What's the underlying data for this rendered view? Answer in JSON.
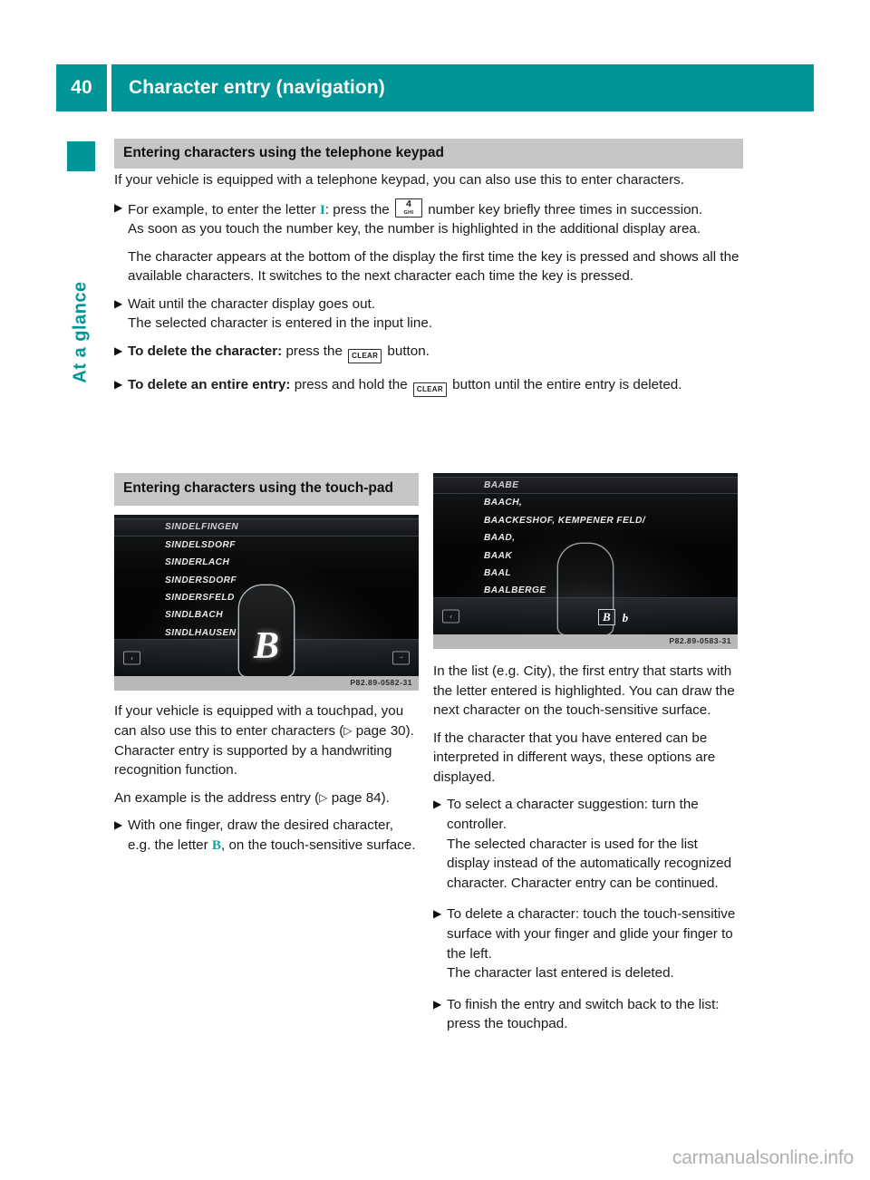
{
  "colors": {
    "accent_teal": "#009597",
    "heading_grey": "#c6c6c6",
    "figure_grey": "#b8b8b8",
    "watermark_grey": "#b0b0b0"
  },
  "header": {
    "page_number": "40",
    "title": "Character entry (navigation)"
  },
  "sidebar": {
    "chapter_label": "At a glance"
  },
  "section_keypad": {
    "heading": "Entering characters using the telephone keypad",
    "intro": "If your vehicle is equipped with a telephone keypad, you can also use this to enter characters.",
    "bullets": [
      {
        "id": "example-letter",
        "text_before": "For example, to enter the letter ",
        "inline_char": "I",
        "text_mid": ": press the ",
        "key": {
          "number": "4",
          "letters": "GHI"
        },
        "text_after": "number key briefly three times in succession.",
        "sub_lines": [
          "As soon as you touch the number key, the number is highlighted in the additional display area.",
          "The character appears at the bottom of the display the first time the key is pressed and shows all the available characters. It switches to the next character each time the key is pressed."
        ]
      },
      {
        "id": "wait-display",
        "text": "Wait until the character display goes out.",
        "sub_lines": [
          "The selected character is entered in the input line."
        ]
      },
      {
        "id": "delete-character",
        "lead": "To delete the character:",
        "text_before": " press the ",
        "key_label": "CLEAR",
        "text_after": " button."
      },
      {
        "id": "delete-entry",
        "lead": "To delete an entire entry:",
        "text_before": " press and hold the ",
        "key_label": "CLEAR",
        "text_after": " button until the entire entry is deleted."
      }
    ]
  },
  "section_touchpad": {
    "heading": "Entering characters using the touch-pad",
    "figure_left": {
      "caption": "P82.89-0582-31",
      "list_items": [
        "SINDELFINGEN",
        "SINDELSDORF",
        "SINDERLACH",
        "SINDERSDORF",
        "SINDERSFELD",
        "SINDLBACH",
        "SINDLHAUSEN"
      ],
      "selected_index": 0,
      "drawn_character": "B",
      "back_button": "‹",
      "forward_button": "→"
    },
    "figure_right": {
      "caption": "P82.89-0583-31",
      "list_items": [
        "BAABE",
        "BAACH,",
        "BAACKESHOF, KEMPENER FELD/",
        "BAAD,",
        "BAAK",
        "BAAL",
        "BAALBERGE"
      ],
      "selected_index": 0,
      "back_button": "‹",
      "suggestions": [
        {
          "label": "B",
          "active": true
        },
        {
          "label": "b",
          "active": false
        }
      ]
    },
    "left_column": {
      "paragraphs": [
        {
          "id": "touchpad-intro",
          "text_before": "If your vehicle is equipped with a touchpad, you can also use this to enter characters (",
          "ref_arrow": "▷",
          "ref_text": " page 30",
          "text_after": "). Character entry is supported by a handwriting recognition function."
        },
        {
          "id": "address-example",
          "text_before": "An example is the address entry (",
          "ref_arrow": "▷",
          "ref_text": " page 84",
          "text_after": ")."
        }
      ],
      "bullets": [
        {
          "id": "draw-character",
          "text_before": "With one finger, draw the desired character, e.g. the letter ",
          "inline_char": "B",
          "text_after": ", on the touch-sensitive surface."
        }
      ]
    },
    "right_column": {
      "paragraphs": [
        {
          "id": "list-highlight",
          "text": "In the list (e.g. City), the first entry that starts with the letter entered is highlighted. You can draw the next character on the touch-sensitive surface."
        },
        {
          "id": "interpretation-options",
          "text": "If the character that you have entered can be interpreted in different ways, these options are displayed."
        }
      ],
      "bullets": [
        {
          "id": "select-suggestion",
          "text": "To select a character suggestion: turn the controller.",
          "sub_lines": [
            "The selected character is used for the list display instead of the automatically recognized character. Character entry can be continued."
          ]
        },
        {
          "id": "delete-character-touch",
          "text": "To delete a character: touch the touch-sensitive surface with your finger and glide your finger to the left.",
          "sub_lines": [
            "The character last entered is deleted."
          ]
        },
        {
          "id": "finish-entry",
          "text": "To finish the entry and switch back to the list: press the touchpad."
        }
      ]
    }
  },
  "footer": {
    "watermark": "carmanualsonline.info"
  }
}
